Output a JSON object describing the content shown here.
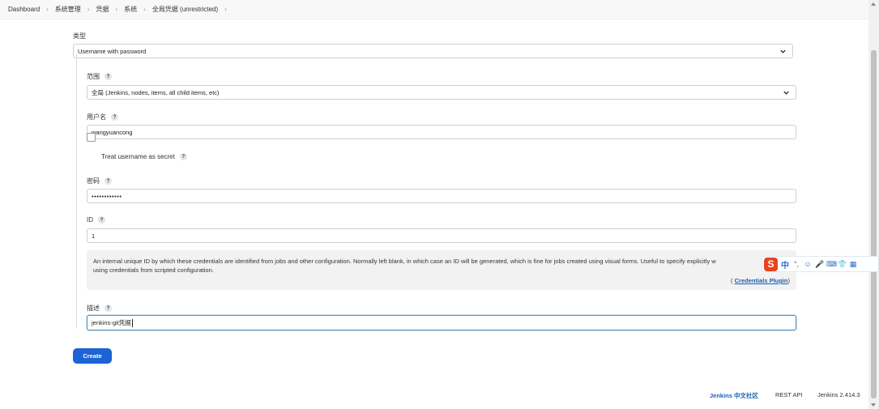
{
  "breadcrumb": [
    "Dashboard",
    "系统管理",
    "凭据",
    "系统",
    "全局凭据 (unrestricted)"
  ],
  "form": {
    "kind_label": "类型",
    "kind_value": "Username with password",
    "scope_label": "范围",
    "scope_value": "全局 (Jenkins, nodes, items, all child items, etc)",
    "username_label": "用户名",
    "username_value": "wangyuancong",
    "secret_checkbox_label": "Treat username as secret",
    "password_label": "密码",
    "password_value": "••••••••••••",
    "id_label": "ID",
    "id_value": "1",
    "id_help_line1": "An internal unique ID by which these credentials are identified from jobs and other configuration. Normally left blank, in which case an ID will be generated, which is fine for jobs created using visual forms. Useful to specify explicitly w",
    "id_help_line2": "using credentials from scripted configuration.",
    "plugin_open": "(",
    "plugin_link": "Credentials Plugin",
    "plugin_close": ")",
    "description_label": "描述",
    "description_value": "jenkins-git凭据",
    "help_mark": "?",
    "create_button": "Create"
  },
  "footer": {
    "community": "Jenkins 中文社区",
    "rest_api": "REST API",
    "version": "Jenkins 2.414.3"
  },
  "ime_toolbar": {
    "logo": "S",
    "lang": "中",
    "icons": [
      "°,",
      "☺",
      "🎤",
      "⌨",
      "👕",
      "▦"
    ]
  },
  "colors": {
    "primary_button": "#1c63d4",
    "link": "#1a5fb4",
    "ime_logo": "#e8431e"
  }
}
